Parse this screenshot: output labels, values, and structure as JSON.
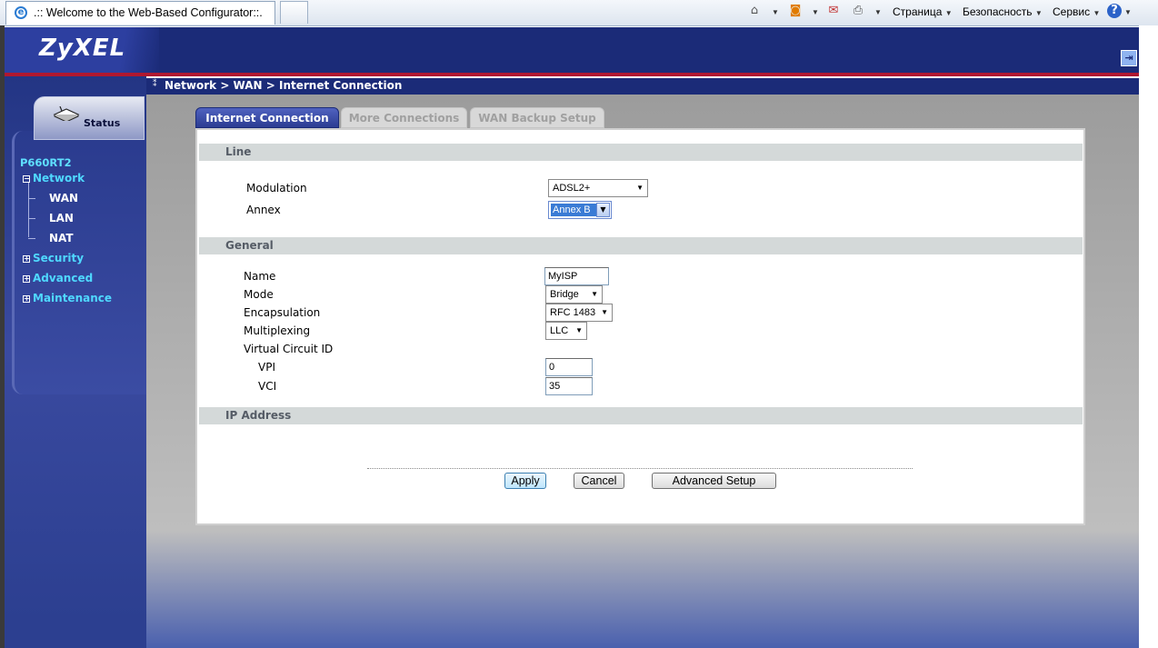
{
  "browser": {
    "tab_title": ".:: Welcome to the Web-Based Configurator::.",
    "toolbar": {
      "page_menu": "Страница",
      "safety_menu": "Безопасность",
      "tools_menu": "Сервис"
    },
    "icons": [
      "ie-icon",
      "home-icon",
      "rss-icon",
      "read-mail-icon",
      "print-icon",
      "help-icon"
    ]
  },
  "header": {
    "logo": "ZyXEL",
    "logout_icon": "logout-icon"
  },
  "sidebar": {
    "status_label": "Status",
    "device_name": "P660RT2",
    "menu": [
      {
        "label": "Network",
        "expanded": true,
        "children": [
          "WAN",
          "LAN",
          "NAT"
        ]
      },
      {
        "label": "Security",
        "expanded": false
      },
      {
        "label": "Advanced",
        "expanded": false
      },
      {
        "label": "Maintenance",
        "expanded": false
      }
    ]
  },
  "breadcrumb": "Network > WAN > Internet Connection",
  "tabs": [
    "Internet Connection",
    "More Connections",
    "WAN Backup Setup"
  ],
  "sections": {
    "line": {
      "title": "Line",
      "modulation_label": "Modulation",
      "modulation_value": "ADSL2+",
      "annex_label": "Annex",
      "annex_value": "Annex B"
    },
    "general": {
      "title": "General",
      "name_label": "Name",
      "name_value": "MyISP",
      "mode_label": "Mode",
      "mode_value": "Bridge",
      "encapsulation_label": "Encapsulation",
      "encapsulation_value": "RFC 1483",
      "multiplexing_label": "Multiplexing",
      "multiplexing_value": "LLC",
      "vcid_label": "Virtual Circuit ID",
      "vpi_label": "VPI",
      "vpi_value": "0",
      "vci_label": "VCI",
      "vci_value": "35"
    },
    "ip": {
      "title": "IP Address"
    }
  },
  "buttons": {
    "apply": "Apply",
    "cancel": "Cancel",
    "advanced": "Advanced Setup"
  }
}
